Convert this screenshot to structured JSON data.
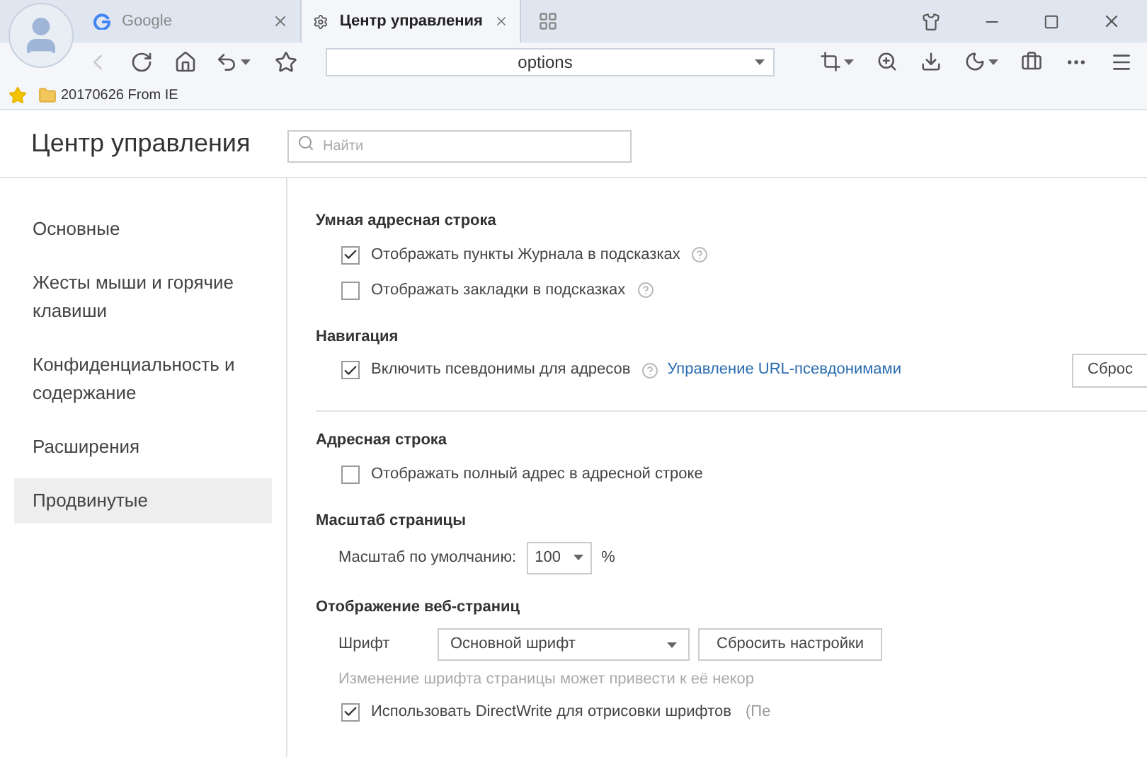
{
  "tabs": [
    {
      "title": "Google",
      "selected": false,
      "kind": "google"
    },
    {
      "title": "Центр управления",
      "selected": true,
      "kind": "settings"
    }
  ],
  "address": {
    "value": "options"
  },
  "bookmarks": [
    {
      "label": "20170626 From IE"
    }
  ],
  "header": {
    "title": "Центр управления",
    "search_placeholder": "Найти"
  },
  "sidebar": {
    "items": [
      {
        "label": "Основные",
        "selected": false
      },
      {
        "label": "Жесты мыши и горячие клавиши",
        "selected": false
      },
      {
        "label": "Конфиденциальность и содержание",
        "selected": false
      },
      {
        "label": "Расширения",
        "selected": false
      },
      {
        "label": "Продвинутые",
        "selected": true
      }
    ]
  },
  "sections": [
    {
      "title": "Умная адресная строка",
      "divider": false,
      "rows": [
        {
          "kind": "checkbox",
          "label": "Отображать пункты Журнала в подсказках",
          "checked": true,
          "help": true
        },
        {
          "kind": "checkbox",
          "label": "Отображать закладки в подсказках",
          "checked": false,
          "help": true
        }
      ]
    },
    {
      "title": "Навигация",
      "divider": true,
      "rows": [
        {
          "kind": "checkbox",
          "label": "Включить псевдонимы для адресов",
          "checked": true,
          "help": true,
          "link": "Управление URL-псевдонимами",
          "button": "Сброс"
        }
      ]
    },
    {
      "title": "Адресная строка",
      "divider": false,
      "rows": [
        {
          "kind": "checkbox",
          "label": "Отображать полный адрес в адресной строке",
          "checked": false,
          "help": false
        }
      ]
    },
    {
      "title": "Масштаб страницы",
      "divider": false,
      "rows": [
        {
          "kind": "zoom",
          "label": "Масштаб по умолчанию:",
          "value": "100",
          "suffix": "%"
        }
      ]
    },
    {
      "title": "Отображение веб-страниц",
      "divider": false,
      "rows": [
        {
          "kind": "font",
          "label": "Шрифт",
          "value": "Основной шрифт",
          "button": "Сбросить настройки"
        },
        {
          "kind": "note",
          "label": "Изменение шрифта страницы может привести к её некор"
        },
        {
          "kind": "checkbox",
          "label": "Использовать DirectWrite для отрисовки шрифтов",
          "checked": true,
          "help": false,
          "extra": "(Пе"
        }
      ]
    }
  ]
}
